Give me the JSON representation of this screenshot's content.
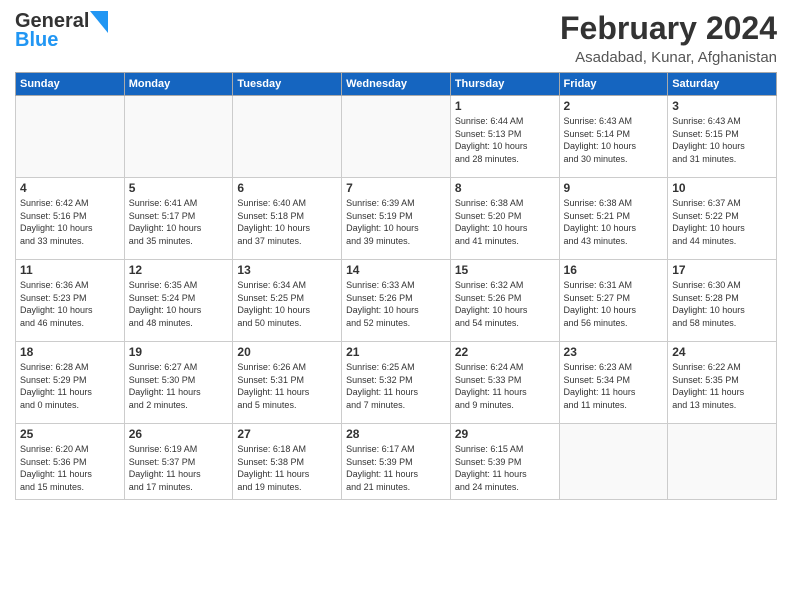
{
  "logo": {
    "general": "General",
    "blue": "Blue"
  },
  "header": {
    "month": "February 2024",
    "location": "Asadabad, Kunar, Afghanistan"
  },
  "weekdays": [
    "Sunday",
    "Monday",
    "Tuesday",
    "Wednesday",
    "Thursday",
    "Friday",
    "Saturday"
  ],
  "weeks": [
    [
      {
        "day": "",
        "info": ""
      },
      {
        "day": "",
        "info": ""
      },
      {
        "day": "",
        "info": ""
      },
      {
        "day": "",
        "info": ""
      },
      {
        "day": "1",
        "info": "Sunrise: 6:44 AM\nSunset: 5:13 PM\nDaylight: 10 hours\nand 28 minutes."
      },
      {
        "day": "2",
        "info": "Sunrise: 6:43 AM\nSunset: 5:14 PM\nDaylight: 10 hours\nand 30 minutes."
      },
      {
        "day": "3",
        "info": "Sunrise: 6:43 AM\nSunset: 5:15 PM\nDaylight: 10 hours\nand 31 minutes."
      }
    ],
    [
      {
        "day": "4",
        "info": "Sunrise: 6:42 AM\nSunset: 5:16 PM\nDaylight: 10 hours\nand 33 minutes."
      },
      {
        "day": "5",
        "info": "Sunrise: 6:41 AM\nSunset: 5:17 PM\nDaylight: 10 hours\nand 35 minutes."
      },
      {
        "day": "6",
        "info": "Sunrise: 6:40 AM\nSunset: 5:18 PM\nDaylight: 10 hours\nand 37 minutes."
      },
      {
        "day": "7",
        "info": "Sunrise: 6:39 AM\nSunset: 5:19 PM\nDaylight: 10 hours\nand 39 minutes."
      },
      {
        "day": "8",
        "info": "Sunrise: 6:38 AM\nSunset: 5:20 PM\nDaylight: 10 hours\nand 41 minutes."
      },
      {
        "day": "9",
        "info": "Sunrise: 6:38 AM\nSunset: 5:21 PM\nDaylight: 10 hours\nand 43 minutes."
      },
      {
        "day": "10",
        "info": "Sunrise: 6:37 AM\nSunset: 5:22 PM\nDaylight: 10 hours\nand 44 minutes."
      }
    ],
    [
      {
        "day": "11",
        "info": "Sunrise: 6:36 AM\nSunset: 5:23 PM\nDaylight: 10 hours\nand 46 minutes."
      },
      {
        "day": "12",
        "info": "Sunrise: 6:35 AM\nSunset: 5:24 PM\nDaylight: 10 hours\nand 48 minutes."
      },
      {
        "day": "13",
        "info": "Sunrise: 6:34 AM\nSunset: 5:25 PM\nDaylight: 10 hours\nand 50 minutes."
      },
      {
        "day": "14",
        "info": "Sunrise: 6:33 AM\nSunset: 5:26 PM\nDaylight: 10 hours\nand 52 minutes."
      },
      {
        "day": "15",
        "info": "Sunrise: 6:32 AM\nSunset: 5:26 PM\nDaylight: 10 hours\nand 54 minutes."
      },
      {
        "day": "16",
        "info": "Sunrise: 6:31 AM\nSunset: 5:27 PM\nDaylight: 10 hours\nand 56 minutes."
      },
      {
        "day": "17",
        "info": "Sunrise: 6:30 AM\nSunset: 5:28 PM\nDaylight: 10 hours\nand 58 minutes."
      }
    ],
    [
      {
        "day": "18",
        "info": "Sunrise: 6:28 AM\nSunset: 5:29 PM\nDaylight: 11 hours\nand 0 minutes."
      },
      {
        "day": "19",
        "info": "Sunrise: 6:27 AM\nSunset: 5:30 PM\nDaylight: 11 hours\nand 2 minutes."
      },
      {
        "day": "20",
        "info": "Sunrise: 6:26 AM\nSunset: 5:31 PM\nDaylight: 11 hours\nand 5 minutes."
      },
      {
        "day": "21",
        "info": "Sunrise: 6:25 AM\nSunset: 5:32 PM\nDaylight: 11 hours\nand 7 minutes."
      },
      {
        "day": "22",
        "info": "Sunrise: 6:24 AM\nSunset: 5:33 PM\nDaylight: 11 hours\nand 9 minutes."
      },
      {
        "day": "23",
        "info": "Sunrise: 6:23 AM\nSunset: 5:34 PM\nDaylight: 11 hours\nand 11 minutes."
      },
      {
        "day": "24",
        "info": "Sunrise: 6:22 AM\nSunset: 5:35 PM\nDaylight: 11 hours\nand 13 minutes."
      }
    ],
    [
      {
        "day": "25",
        "info": "Sunrise: 6:20 AM\nSunset: 5:36 PM\nDaylight: 11 hours\nand 15 minutes."
      },
      {
        "day": "26",
        "info": "Sunrise: 6:19 AM\nSunset: 5:37 PM\nDaylight: 11 hours\nand 17 minutes."
      },
      {
        "day": "27",
        "info": "Sunrise: 6:18 AM\nSunset: 5:38 PM\nDaylight: 11 hours\nand 19 minutes."
      },
      {
        "day": "28",
        "info": "Sunrise: 6:17 AM\nSunset: 5:39 PM\nDaylight: 11 hours\nand 21 minutes."
      },
      {
        "day": "29",
        "info": "Sunrise: 6:15 AM\nSunset: 5:39 PM\nDaylight: 11 hours\nand 24 minutes."
      },
      {
        "day": "",
        "info": ""
      },
      {
        "day": "",
        "info": ""
      }
    ]
  ]
}
